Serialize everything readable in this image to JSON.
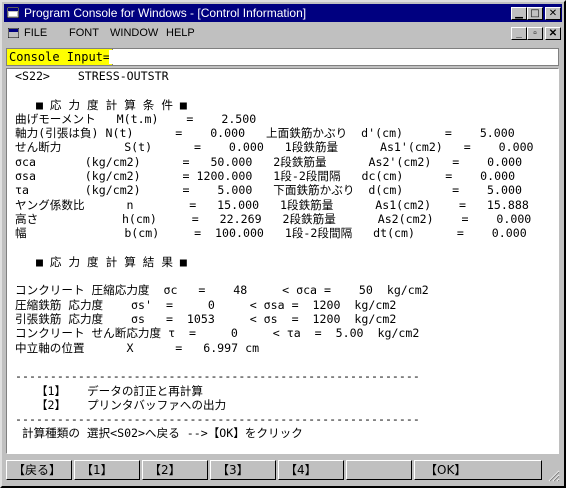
{
  "window": {
    "title": "Program Console for Windows - [Control Information]"
  },
  "caption_buttons": {
    "minimize": "▁",
    "maximize": "□",
    "close": "✕"
  },
  "menu": {
    "items": [
      "FILE",
      "FONT",
      "WINDOW",
      "HELP"
    ]
  },
  "mdi_buttons": {
    "minimize": "_",
    "restore": "▫",
    "close": "✕"
  },
  "console": {
    "label": "Console Input=",
    "value": ""
  },
  "content_lines": [
    "<S22>    STRESS-OUTSTR",
    "",
    "   ■ 応 力 度 計 算 条 件 ■",
    "曲げモーメント   M(t.m)    =    2.500",
    "軸力(引張は負) N(t)      =    0.000   上面鉄筋かぶり  d'(cm)      =    5.000",
    "せん断力         S(t)      =    0.000   1段鉄筋量      As1'(cm2)   =    0.000",
    "σca       (kg/cm2)      =   50.000   2段鉄筋量      As2'(cm2)   =    0.000",
    "σsa       (kg/cm2)      = 1200.000   1段-2段間隔   dc(cm)      =    0.000",
    "τa        (kg/cm2)      =    5.000   下面鉄筋かぶり  d(cm)       =    5.000",
    "ヤング係数比      n        =   15.000   1段鉄筋量      As1(cm2)    =   15.888",
    "高さ            h(cm)     =   22.269   2段鉄筋量      As2(cm2)    =    0.000",
    "幅              b(cm)     =  100.000   1段-2段間隔   dt(cm)      =    0.000",
    "",
    "   ■ 応 力 度 計 算 結 果 ■",
    "",
    "コンクリート 圧縮応力度  σc   =    48     < σca =    50  kg/cm2",
    "圧縮鉄筋 応力度    σs'  =     0     < σsa =  1200  kg/cm2",
    "引張鉄筋 応力度    σs   =  1053     < σs  =  1200  kg/cm2",
    "コンクリート せん断応力度 τ  =     0     < τa  =  5.00  kg/cm2",
    "中立軸の位置      X      =   6.997 cm",
    "",
    "----------------------------------------------------------",
    "   【1】   データの訂正と再計算",
    "   【2】   プリンタバッファへの出力",
    "----------------------------------------------------------",
    " 計算種類の 選択<S02>へ戻る -->【OK】をクリック"
  ],
  "function_keys": [
    "【戻る】",
    "【1】",
    "【2】",
    "【3】",
    "【4】",
    "",
    "【OK】"
  ],
  "colors": {
    "titlebar": "#000080",
    "console_label_bg": "#ffff00",
    "chrome": "#c0c0c0"
  }
}
